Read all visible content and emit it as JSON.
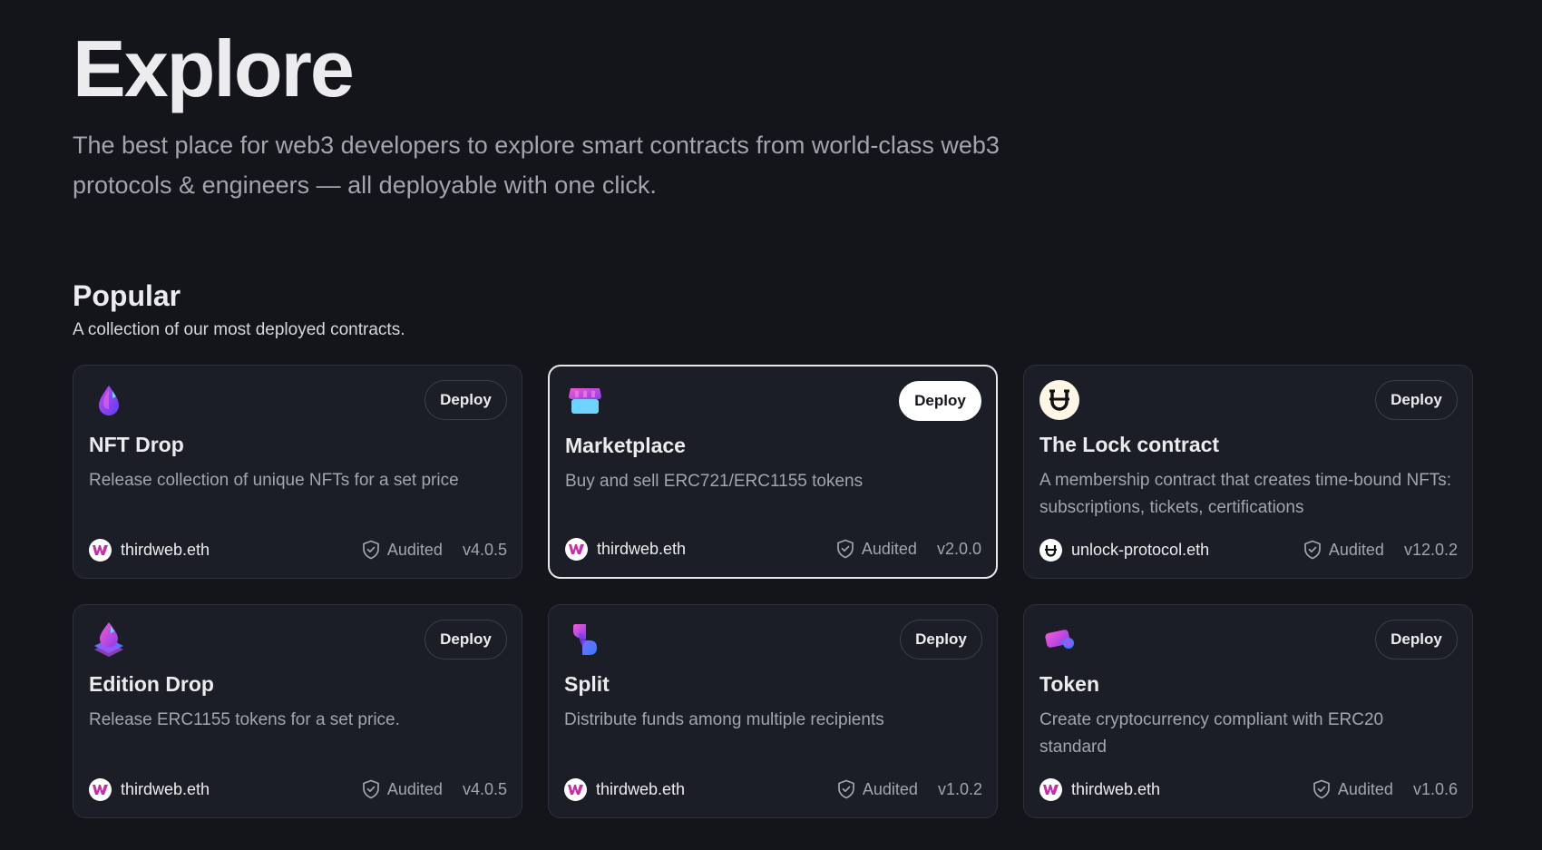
{
  "hero": {
    "title": "Explore",
    "subtitle": "The best place for web3 developers to explore smart contracts from world-class web3 protocols & engineers — all deployable with one click."
  },
  "popular": {
    "title": "Popular",
    "subtitle": "A collection of our most deployed contracts."
  },
  "colors": {
    "background": "#13151b",
    "card": "#1b1e26",
    "text_primary": "#ececee",
    "text_secondary": "#a3a5ad"
  },
  "cards": [
    {
      "logo_icon": "nft-drop-droplet-icon",
      "deploy_label": "Deploy",
      "title": "NFT Drop",
      "description": "Release collection of unique NFTs for a set price",
      "publisher": "thirdweb.eth",
      "publisher_icon": "thirdweb-avatar-icon",
      "audited_label": "Audited",
      "version": "v4.0.5"
    },
    {
      "logo_icon": "marketplace-store-icon",
      "deploy_label": "Deploy",
      "title": "Marketplace",
      "description": "Buy and sell ERC721/ERC1155 tokens",
      "publisher": "thirdweb.eth",
      "publisher_icon": "thirdweb-avatar-icon",
      "audited_label": "Audited",
      "version": "v2.0.0"
    },
    {
      "logo_icon": "unlock-protocol-icon",
      "deploy_label": "Deploy",
      "title": "The Lock contract",
      "description": "A membership contract that creates time-bound NFTs: subscriptions, tickets, certifications",
      "publisher": "unlock-protocol.eth",
      "publisher_icon": "unlock-avatar-icon",
      "audited_label": "Audited",
      "version": "v12.0.2"
    },
    {
      "logo_icon": "edition-drop-icon",
      "deploy_label": "Deploy",
      "title": "Edition Drop",
      "description": "Release ERC1155 tokens for a set price.",
      "publisher": "thirdweb.eth",
      "publisher_icon": "thirdweb-avatar-icon",
      "audited_label": "Audited",
      "version": "v4.0.5"
    },
    {
      "logo_icon": "split-icon",
      "deploy_label": "Deploy",
      "title": "Split",
      "description": "Distribute funds among multiple recipients",
      "publisher": "thirdweb.eth",
      "publisher_icon": "thirdweb-avatar-icon",
      "audited_label": "Audited",
      "version": "v1.0.2"
    },
    {
      "logo_icon": "token-coin-icon",
      "deploy_label": "Deploy",
      "title": "Token",
      "description": "Create cryptocurrency compliant with ERC20 standard",
      "publisher": "thirdweb.eth",
      "publisher_icon": "thirdweb-avatar-icon",
      "audited_label": "Audited",
      "version": "v1.0.6"
    }
  ]
}
